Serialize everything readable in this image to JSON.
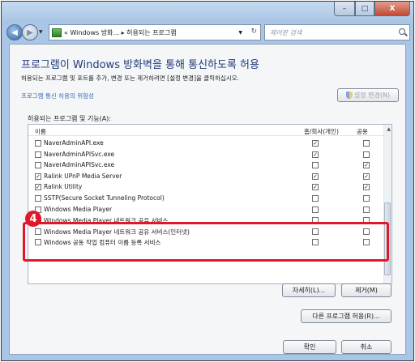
{
  "window": {
    "caption": {
      "minimize": "–",
      "maximize": "□",
      "close": "X"
    }
  },
  "nav": {
    "breadcrumb": "« Windows 방화... ▸ 허용되는 프로그램",
    "search_placeholder": "제어판 검색"
  },
  "page": {
    "title": "프로그램이 Windows 방화벽을 통해 통신하도록 허용",
    "instruction": "허용되는 프로그램 및 포트를 추가, 변경 또는 제거하려면 [설정 변경]을 클릭하십시오.",
    "risk_link": "프로그램 통신 허용의 위험성",
    "change_settings": "설정 변경(N)",
    "list_label": "허용되는 프로그램 및 기능(A):"
  },
  "table": {
    "headers": {
      "name": "이름",
      "home": "홈/회사(개인)",
      "public": "공용"
    },
    "rows": [
      {
        "name": "NaverAdminAPI.exe",
        "enabled": false,
        "home": true,
        "public": false
      },
      {
        "name": "NaverAdminAPISvc.exe",
        "enabled": false,
        "home": true,
        "public": false
      },
      {
        "name": "NaverAdminAPISvc.exe",
        "enabled": false,
        "home": false,
        "public": true
      },
      {
        "name": "Ralink UPnP Media Server",
        "enabled": true,
        "home": true,
        "public": true
      },
      {
        "name": "Ralink Utility",
        "enabled": true,
        "home": true,
        "public": true
      },
      {
        "name": "SSTP(Secure Socket Tunneling Protocol)",
        "enabled": false,
        "home": false,
        "public": false
      },
      {
        "name": "Windows Media Player",
        "enabled": false,
        "home": false,
        "public": false
      },
      {
        "name": "Windows Media Player 네트워크 공유 서비스",
        "enabled": false,
        "home": false,
        "public": false
      },
      {
        "name": "Windows Media Player 네트워크 공유 서비스(인터넷)",
        "enabled": false,
        "home": false,
        "public": false
      },
      {
        "name": "Windows 공동 작업 컴퓨터 이름 등록 서비스",
        "enabled": false,
        "home": false,
        "public": false
      }
    ]
  },
  "annotation": {
    "badge": "4",
    "color": "#e0182a"
  },
  "buttons": {
    "details": "자세히(L)...",
    "remove": "제거(M)",
    "allow_other": "다른 프로그램 허용(R)...",
    "ok": "확인",
    "cancel": "취소"
  }
}
